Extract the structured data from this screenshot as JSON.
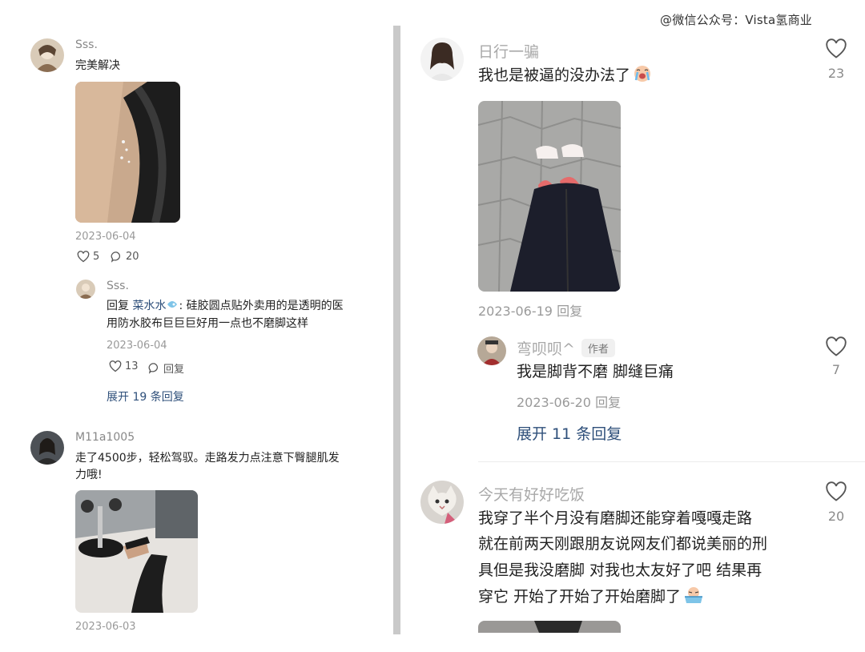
{
  "watermark": "@微信公众号：Vista氢商业",
  "left": {
    "comments": [
      {
        "user": "Sss.",
        "text": "完美解决",
        "date": "2023-06-04",
        "likes": "5",
        "replies": "20",
        "reply": {
          "user": "Sss.",
          "prefix": "回复",
          "mention": "菜水水",
          "text_line1": ": 硅胶圆点贴外卖用的是透明的医",
          "text_line2": "用防水胶布巨巨巨好用一点也不磨脚这样",
          "date": "2023-06-04",
          "likes": "13",
          "reply_label": "回复"
        },
        "expand": "展开 19 条回复"
      },
      {
        "user": "M11a1005",
        "text_line1": "走了4500步，轻松驾驭。走路发力点注意下臀腿肌发",
        "text_line2": "力哦!",
        "date": "2023-06-03"
      }
    ]
  },
  "right": {
    "comments": [
      {
        "user": "日行一骗",
        "text": "我也是被逼的没办法了",
        "emoji": "crying-face",
        "date_reply": "2023-06-19 回复",
        "likes": "23"
      },
      {
        "user": "弯呗呗^",
        "tag": "作者",
        "text": "我是脚背不磨 脚缝巨痛",
        "date_reply": "2023-06-20 回复",
        "likes": "7",
        "expand": "展开 11 条回复"
      },
      {
        "user": "今天有好好吃饭",
        "text_lines": [
          "我穿了半个月没有磨脚还能穿着嘎嘎走路",
          "就在前两天刚跟朋友说网友们都说美丽的刑",
          "具但是我没磨脚 对我也太友好了吧 结果再",
          "穿它 开始了开始了开始磨脚了"
        ],
        "emoji": "crying-in-bath",
        "likes": "20"
      }
    ]
  },
  "colors": {
    "link": "#2e4f7a",
    "divider": "#c9c9c9",
    "name_gray": "#a9a9a9",
    "text": "#222222"
  }
}
